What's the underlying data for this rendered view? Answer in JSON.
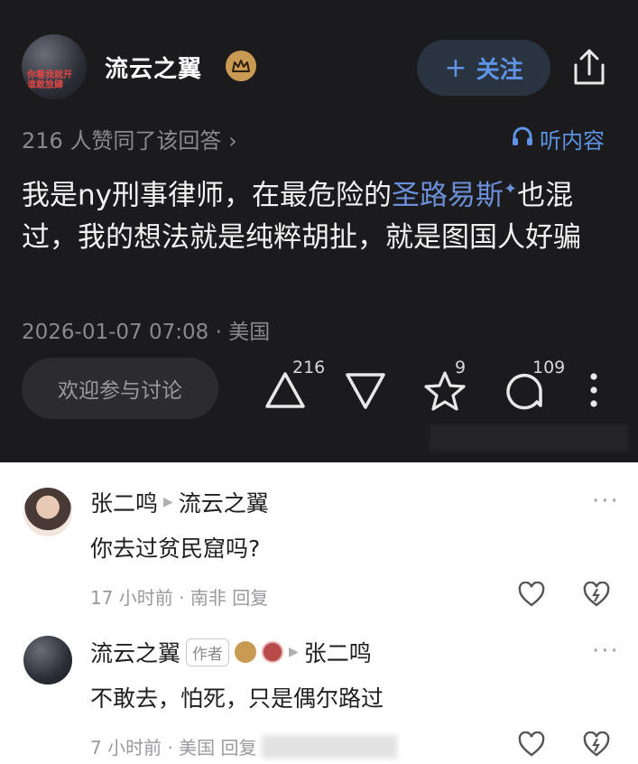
{
  "author": {
    "name": "流云之翼",
    "avatar_caption": "你看我就开\n谁敢放肆"
  },
  "follow_button": {
    "plus": "+",
    "label": "关注"
  },
  "likes_summary": "216 人赞同了该回答 ›",
  "listen_label": "听内容",
  "answer": {
    "part1": "我是ny刑事律师，在最危险的",
    "link": "圣路易斯",
    "spark": "✦",
    "part2": "也混过，我的想法就是纯粹胡扯，就是图国人好骗"
  },
  "meta": "2026-01-07 07:08 · 美国",
  "discuss_placeholder": "欢迎参与讨论",
  "actions": {
    "upvote_count": "216",
    "star_count": "9",
    "comment_count": "109"
  },
  "comments": [
    {
      "user": "张二鸣",
      "reply_to": "流云之翼",
      "text": "你去过贫民窟吗?",
      "meta": "17 小时前 · 南非 回复"
    },
    {
      "user": "流云之翼",
      "author_badge": "作者",
      "reply_to": "张二鸣",
      "text": "不敢去，怕死，只是偶尔路过",
      "meta": "7 小时前 · 美国 回复"
    }
  ],
  "colors": {
    "dark_bg": "#1b1b1d",
    "accent_blue": "#5e93e6",
    "link_blue": "#6b8fd8",
    "crown_gold": "#c99a52"
  }
}
